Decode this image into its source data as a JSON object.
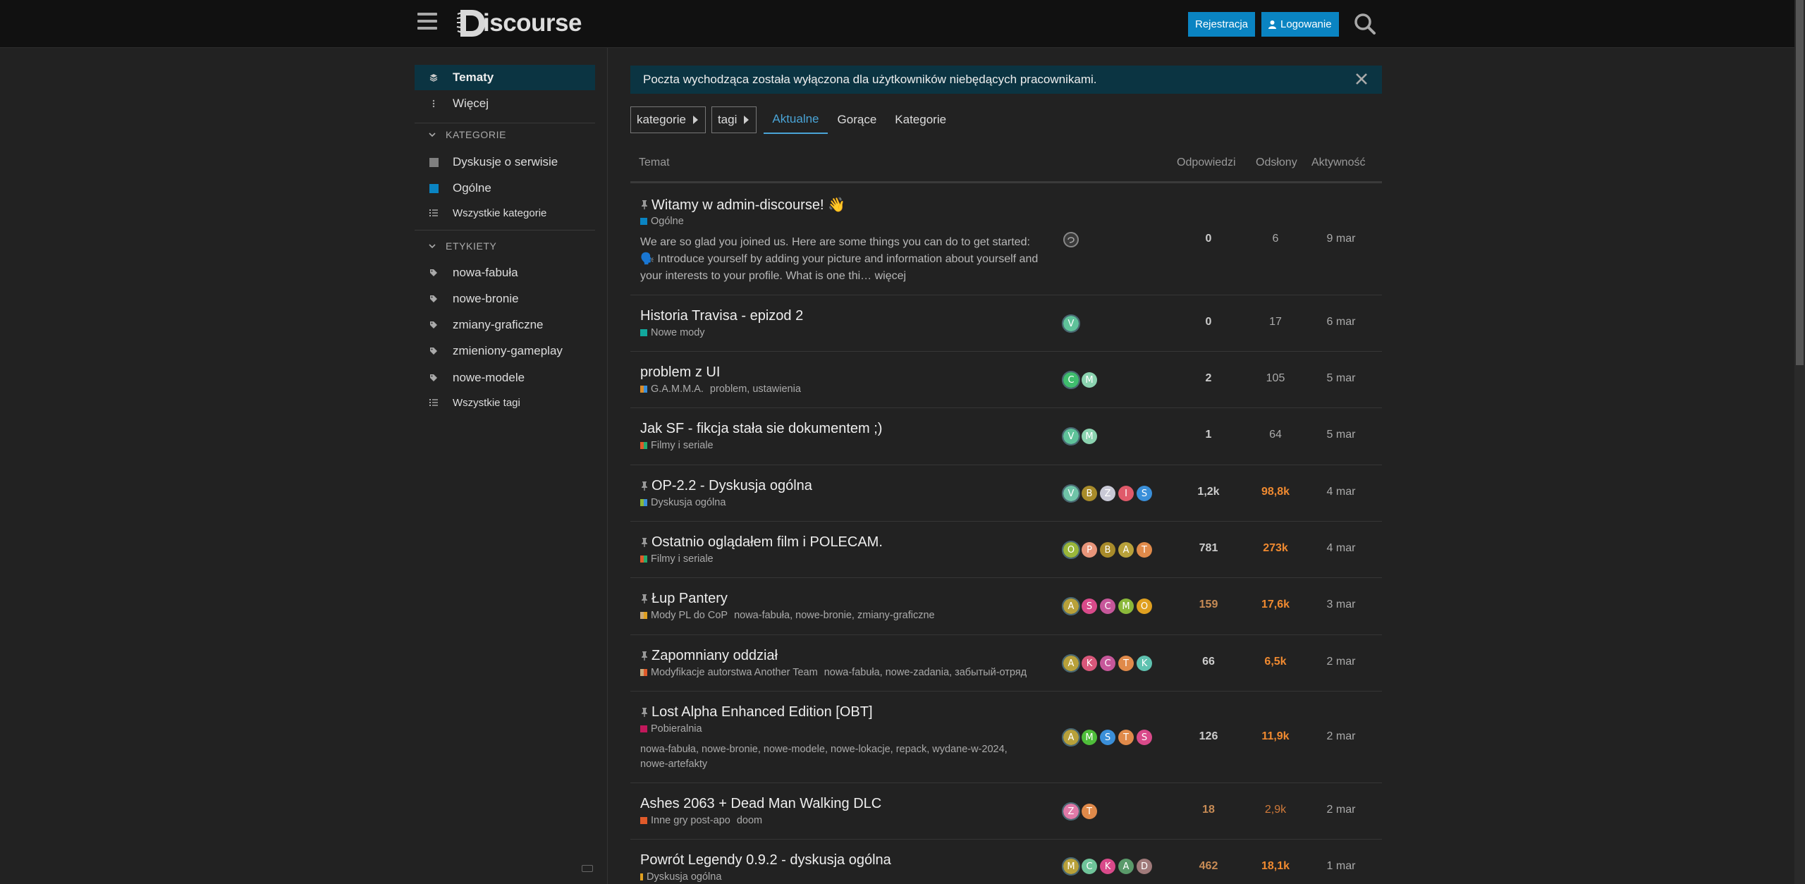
{
  "header": {
    "logo_text": "iscourse",
    "register_label": "Rejestracja",
    "login_label": "Logowanie"
  },
  "banner": {
    "text": "Poczta wychodząca została wyłączona dla użytkowników niebędących pracownikami."
  },
  "sidebar": {
    "topics_label": "Tematy",
    "more_label": "Więcej",
    "categories_heading": "KATEGORIE",
    "categories": [
      {
        "label": "Dyskusje o serwisie",
        "color": "#808080"
      },
      {
        "label": "Ogólne",
        "color": "#0a84c2"
      }
    ],
    "all_categories_label": "Wszystkie kategorie",
    "tags_heading": "ETYKIETY",
    "tags": [
      "nowa-fabuła",
      "nowe-bronie",
      "zmiany-graficzne",
      "zmieniony-gameplay",
      "nowe-modele"
    ],
    "all_tags_label": "Wszystkie tagi"
  },
  "nav": {
    "categories_dropdown": "kategorie",
    "tags_dropdown": "tagi",
    "tabs": [
      "Aktualne",
      "Gorące",
      "Kategorie"
    ]
  },
  "table_header": {
    "topic": "Temat",
    "replies": "Odpowiedzi",
    "views": "Odsłony",
    "activity": "Aktywność"
  },
  "topics": [
    {
      "title": "Witamy w admin-discourse! 👋",
      "pinned": true,
      "category": "Ogólne",
      "category_color": "#0a84c2",
      "tags": "",
      "excerpt": "We are so glad you joined us. Here are some things you can do to get started: 🗣️ Introduce yourself by adding your picture and information about yourself and your interests to your profile. What is one thi… więcej",
      "posters": [
        {
          "letter": "",
          "color": "#555555"
        }
      ],
      "replies": "0",
      "views": "6",
      "activity": "9 mar"
    },
    {
      "title": "Historia Travisa - epizod 2",
      "pinned": false,
      "category": "Nowe mody",
      "category_color": "#12a89d",
      "tags": "",
      "posters": [
        {
          "letter": "V",
          "color": "#5fc29a"
        }
      ],
      "replies": "0",
      "views": "17",
      "activity": "6 mar"
    },
    {
      "title": "problem z UI",
      "pinned": false,
      "category": "G.A.M.M.A.",
      "category_color": "#d98c2b",
      "tags": "problem, ustawienia",
      "posters": [
        {
          "letter": "C",
          "color": "#3fbe6e"
        },
        {
          "letter": "M",
          "color": "#8bd3b0"
        }
      ],
      "replies": "2",
      "views": "105",
      "activity": "5 mar"
    },
    {
      "title": "Jak SF - fikcja stała sie dokumentem ;)",
      "pinned": false,
      "category": "Filmy i seriale",
      "category_color": "#27a96c",
      "tags": "",
      "posters": [
        {
          "letter": "V",
          "color": "#5fc29a"
        },
        {
          "letter": "M",
          "color": "#8bd3b0"
        }
      ],
      "replies": "1",
      "views": "64",
      "activity": "5 mar"
    },
    {
      "title": "OP-2.2 - Dyskusja ogólna",
      "pinned": true,
      "category": "Dyskusja ogólna",
      "category_color": "#8ab83a",
      "tags": "",
      "posters": [
        {
          "letter": "V",
          "color": "#6fc4a8"
        },
        {
          "letter": "B",
          "color": "#a88b2a"
        },
        {
          "letter": "Z",
          "color": "#c9c9d6"
        },
        {
          "letter": "I",
          "color": "#e05a6a"
        },
        {
          "letter": "S",
          "color": "#3a8fd9"
        }
      ],
      "replies": "1,2k",
      "views": "98,8k",
      "activity": "4 mar"
    },
    {
      "title": "Ostatnio oglądałem film i POLECAM.",
      "pinned": true,
      "category": "Filmy i seriale",
      "category_color": "#27a96c",
      "tags": "",
      "posters": [
        {
          "letter": "O",
          "color": "#9ab83a"
        },
        {
          "letter": "P",
          "color": "#e8957a"
        },
        {
          "letter": "B",
          "color": "#a88b2a"
        },
        {
          "letter": "A",
          "color": "#b8a13a"
        },
        {
          "letter": "T",
          "color": "#e08a4a"
        }
      ],
      "replies": "781",
      "views": "273k",
      "activity": "4 mar"
    },
    {
      "title": "Łup Pantery",
      "pinned": true,
      "category": "Mody PL do CoP",
      "category_color": "#c9a97a",
      "tags": "nowa-fabuła, nowe-bronie, zmiany-graficzne",
      "posters": [
        {
          "letter": "A",
          "color": "#b8a13a"
        },
        {
          "letter": "S",
          "color": "#d94a8a"
        },
        {
          "letter": "C",
          "color": "#c6579a"
        },
        {
          "letter": "M",
          "color": "#8ab83a"
        },
        {
          "letter": "O",
          "color": "#e0a020"
        }
      ],
      "replies": "159",
      "views": "17,6k",
      "activity": "3 mar"
    },
    {
      "title": "Zapomniany oddział",
      "pinned": true,
      "category": "Modyfikacje autorstwa Another Team",
      "category_color": "#c9a97a",
      "tags": "nowa-fabuła, nowe-zadania, забытый-отряд",
      "posters": [
        {
          "letter": "A",
          "color": "#b8a13a"
        },
        {
          "letter": "K",
          "color": "#d9577a"
        },
        {
          "letter": "C",
          "color": "#c6579a"
        },
        {
          "letter": "T",
          "color": "#e08a4a"
        },
        {
          "letter": "K",
          "color": "#5fc2b0"
        }
      ],
      "replies": "66",
      "views": "6,5k",
      "activity": "2 mar"
    },
    {
      "title": "Lost Alpha Enhanced Edition [OBT]",
      "pinned": true,
      "category": "Pobieralnia",
      "category_color": "#c2185b",
      "tags": "nowa-fabuła, nowe-bronie, nowe-modele, nowe-lokacje, repack, wydane-w-2024, nowe-artefakty",
      "posters": [
        {
          "letter": "A",
          "color": "#b8a13a"
        },
        {
          "letter": "M",
          "color": "#4fbe3a"
        },
        {
          "letter": "S",
          "color": "#3a8fd9"
        },
        {
          "letter": "T",
          "color": "#e08a4a"
        },
        {
          "letter": "S",
          "color": "#d94a8a"
        }
      ],
      "replies": "126",
      "views": "11,9k",
      "activity": "2 mar"
    },
    {
      "title": "Ashes 2063 + Dead Man Walking DLC",
      "pinned": false,
      "category": "Inne gry post-apo",
      "category_color": "#e05a2a",
      "tags": "doom",
      "posters": [
        {
          "letter": "Z",
          "color": "#e07aa8"
        },
        {
          "letter": "T",
          "color": "#e08a4a"
        }
      ],
      "replies": "18",
      "views": "2,9k",
      "activity": "2 mar"
    },
    {
      "title": "Powrót Legendy 0.9.2 - dyskusja ogólna",
      "pinned": false,
      "category": "Dyskusja ogólna",
      "category_color": "#e0a020",
      "tags": "",
      "posters": [
        {
          "letter": "M",
          "color": "#b8a13a"
        },
        {
          "letter": "C",
          "color": "#6fc49a"
        },
        {
          "letter": "K",
          "color": "#d94a8a"
        },
        {
          "letter": "A",
          "color": "#5a9a6a"
        },
        {
          "letter": "D",
          "color": "#a07a7a"
        }
      ],
      "replies": "462",
      "views": "18,1k",
      "activity": "1 mar"
    }
  ]
}
